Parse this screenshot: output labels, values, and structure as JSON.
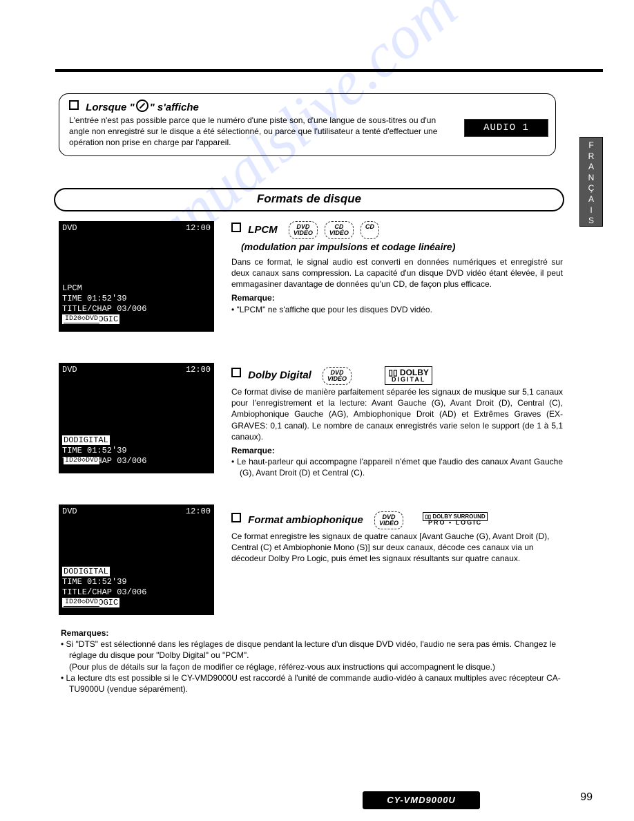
{
  "side_tab": "F\nR\nA\nN\nÇ\nA\nI\nS",
  "note": {
    "title_prefix": "Lorsque \"",
    "title_suffix": "\" s'affiche",
    "body": "L'entrée n'est pas possible parce que le numéro d'une piste son, d'une langue de sous-titres ou d'un angle non enregistré sur le disque a été sélectionné, ou parce que l'utilisateur a tenté d'effectuer une opération non prise en charge par l'appareil.",
    "audio_label": "AUDIO 1"
  },
  "section_title": "Formats de disque",
  "screenshots": {
    "s1": {
      "top_left": "DVD",
      "top_right": "12:00",
      "l1": "LPCM",
      "l2": "TIME 01:52'39",
      "l3": "TITLE/CHAP 03/006",
      "l4_inv": "DOPRO LOGIC",
      "footer": "ID20◇DVD"
    },
    "s2": {
      "top_left": "DVD",
      "top_right": "12:00",
      "l1": "DODIGITAL",
      "l2": "TIME 01:52'39",
      "l3": "TITLE/CHAP 03/006",
      "footer": "ID20◇DVD"
    },
    "s3": {
      "top_left": "DVD",
      "top_right": "12:00",
      "l1": "DODIGITAL",
      "l2": "TIME 01:52'39",
      "l3": "TITLE/CHAP 03/006",
      "l4_inv": "DOPRO LOGIC",
      "footer": "ID20◇DVD"
    }
  },
  "media": {
    "dvd_video": "DVD\nVIDÉO",
    "cd_video": "CD\nVIDÉO",
    "cd": "CD"
  },
  "dolby": {
    "dd": "▯▯ DOLBY",
    "digital": "DIGITAL",
    "surround_top": "▯▯ DOLBY SURROUND",
    "surround_bot": "PRO • LOGIC"
  },
  "lpcm": {
    "title": "LPCM",
    "subtitle": "(modulation par impulsions et codage linéaire)",
    "body": "Dans ce format, le signal audio est converti en données numériques et enregistré sur deux canaux sans compression. La capacité d'un disque DVD vidéo étant élevée, il peut emmagasiner davantage de données qu'un CD, de façon plus efficace.",
    "remarque_label": "Remarque:",
    "remarque_bullet": "• \"LPCM\" ne s'affiche que pour les disques DVD vidéo."
  },
  "ddolby": {
    "title": "Dolby Digital",
    "body": "Ce format divise de manière parfaitement séparée les signaux de musique sur 5,1 canaux pour l'enregistrement et la lecture: Avant Gauche (G), Avant Droit (D), Central (C), Ambiophonique Gauche (AG), Ambiophonique Droit (AD) et Extrêmes Graves (EX-GRAVES: 0,1 canal). Le nombre de canaux enregistrés varie selon le support (de 1 à 5,1 canaux).",
    "remarque_label": "Remarque:",
    "remarque_bullet": "• Le haut-parleur qui accompagne l'appareil n'émet que l'audio des canaux Avant Gauche (G), Avant Droit (D) et Central (C)."
  },
  "ambio": {
    "title": "Format ambiophonique",
    "body": "Ce format enregistre les signaux de quatre canaux [Avant Gauche (G), Avant Droit (D), Central (C) et Ambiophonie Mono (S)] sur deux canaux, décode ces canaux via un décodeur Dolby Pro Logic, puis émet les signaux résultants sur quatre canaux."
  },
  "remarques": {
    "label": "Remarques:",
    "b1a": "• Si \"DTS\" est sélectionné dans les réglages de disque pendant la lecture d'un disque DVD vidéo, l'audio ne sera pas émis. Changez le réglage du disque pour \"Dolby Digital\" ou \"PCM\".",
    "b1b": "(Pour plus de détails sur la façon de modifier ce réglage, référez-vous aux instructions qui accompagnent le disque.)",
    "b2": "• La lecture dts est possible si le CY-VMD9000U est raccordé à l'unité de commande audio-vidéo à canaux multiples avec récepteur CA-TU9000U (vendue séparément)."
  },
  "model": "CY-VMD9000U",
  "page_number": "99",
  "watermark": "manualslive.com"
}
